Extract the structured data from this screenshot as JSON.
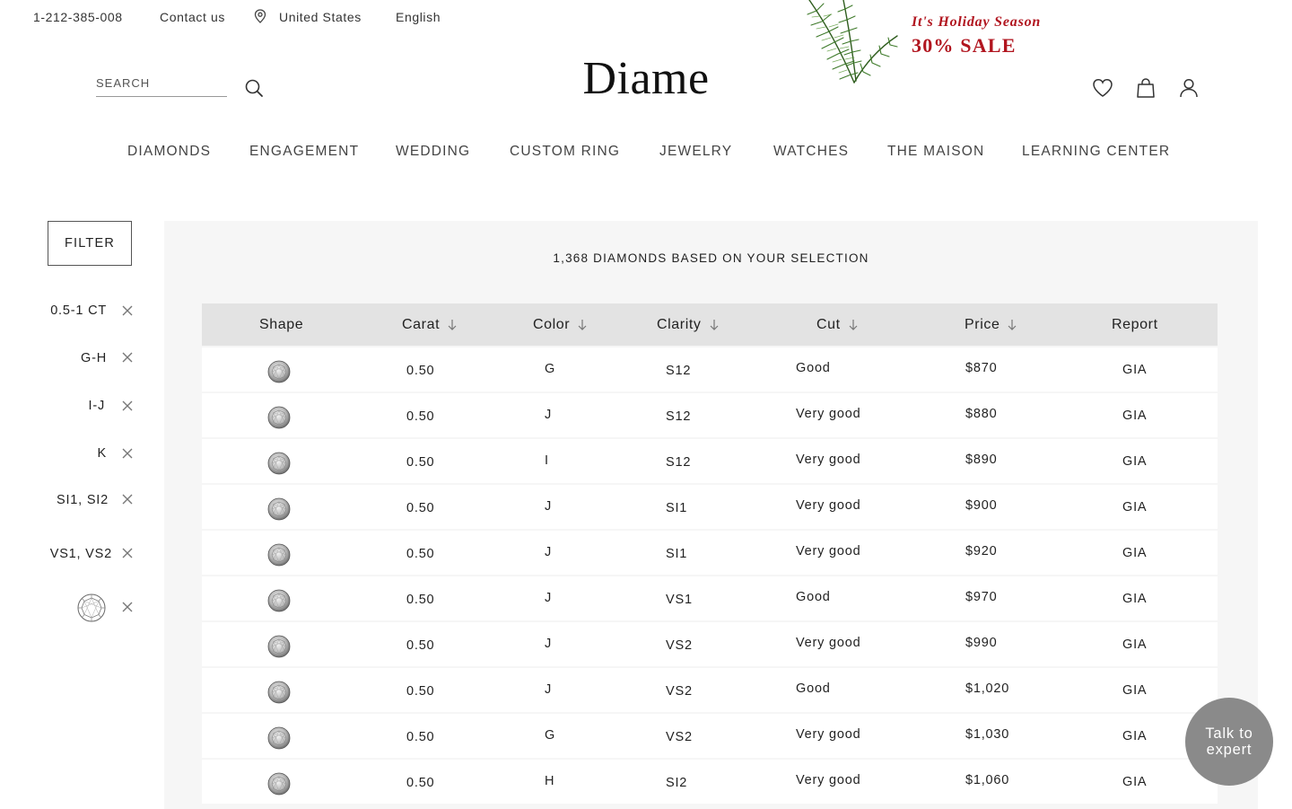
{
  "topbar": {
    "phone": "1-212-385-008",
    "contact": "Contact us",
    "country": "United States",
    "language": "English"
  },
  "promo": {
    "line1": "It's Holiday Season",
    "line2": "30% SALE",
    "color": "#b1151f"
  },
  "search": {
    "placeholder": "SEARCH"
  },
  "logo": "Diame",
  "header_icons": [
    "heart-icon",
    "shopping-bag-icon",
    "user-icon"
  ],
  "nav": [
    "DIAMONDS",
    "ENGAGEMENT",
    "WEDDING",
    "CUSTOM RING",
    "JEWELRY",
    "WATCHES",
    "THE MAISON",
    "LEARNING CENTER"
  ],
  "filter": {
    "button": "FILTER",
    "chips": [
      "0.5-1 CT",
      "G-H",
      "I-J",
      "K",
      "SI1, SI2",
      "VS1, VS2"
    ],
    "shape_chip": "round-shape-icon"
  },
  "results": {
    "count_text": "1,368 DIAMONDS BASED ON YOUR SELECTION",
    "columns": [
      "Shape",
      "Carat",
      "Color",
      "Clarity",
      "Cut",
      "Price",
      "Report"
    ],
    "rows": [
      {
        "carat": "0.50",
        "color": "G",
        "clarity": "S12",
        "cut": "Good",
        "price": "$870",
        "report": "GIA"
      },
      {
        "carat": "0.50",
        "color": "J",
        "clarity": "S12",
        "cut": "Very good",
        "price": "$880",
        "report": "GIA"
      },
      {
        "carat": "0.50",
        "color": "I",
        "clarity": "S12",
        "cut": "Very good",
        "price": "$890",
        "report": "GIA"
      },
      {
        "carat": "0.50",
        "color": "J",
        "clarity": "SI1",
        "cut": "Very good",
        "price": "$900",
        "report": "GIA"
      },
      {
        "carat": "0.50",
        "color": "J",
        "clarity": "SI1",
        "cut": "Very good",
        "price": "$920",
        "report": "GIA"
      },
      {
        "carat": "0.50",
        "color": "J",
        "clarity": "VS1",
        "cut": "Good",
        "price": "$970",
        "report": "GIA"
      },
      {
        "carat": "0.50",
        "color": "J",
        "clarity": "VS2",
        "cut": "Very good",
        "price": "$990",
        "report": "GIA"
      },
      {
        "carat": "0.50",
        "color": "J",
        "clarity": "VS2",
        "cut": "Good",
        "price": "$1,020",
        "report": "GIA"
      },
      {
        "carat": "0.50",
        "color": "G",
        "clarity": "VS2",
        "cut": "Very good",
        "price": "$1,030",
        "report": "GIA"
      },
      {
        "carat": "0.50",
        "color": "H",
        "clarity": "SI2",
        "cut": "Very good",
        "price": "$1,060",
        "report": "GIA"
      }
    ]
  },
  "expert": {
    "line1": "Talk to",
    "line2": "expert"
  }
}
